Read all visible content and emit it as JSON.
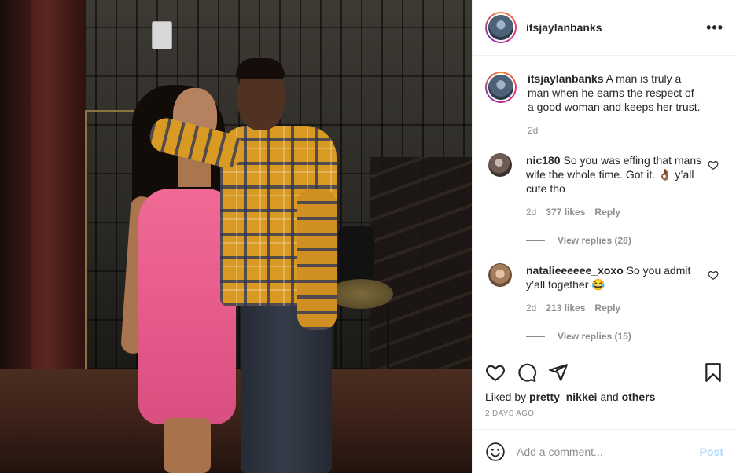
{
  "post": {
    "username": "itsjaylanbanks",
    "more_label": "•••"
  },
  "caption": {
    "username": "itsjaylanbanks",
    "text": "A man is truly a man when he earns the respect of a good woman and keeps her trust.",
    "time": "2d"
  },
  "comments": [
    {
      "username": "nic180",
      "text": "So you was effing that mans wife the whole time. Got it. 👌🏾 y’all cute tho",
      "time": "2d",
      "likes": "377 likes",
      "reply_label": "Reply",
      "view_replies": "View replies (28)"
    },
    {
      "username": "natalieeeeee_xoxo",
      "text": "So you admit y’all together 😂",
      "time": "2d",
      "likes": "213 likes",
      "reply_label": "Reply",
      "view_replies": "View replies (15)"
    }
  ],
  "actions": {
    "icons": [
      "heart-icon",
      "comment-icon",
      "share-icon",
      "bookmark-icon"
    ]
  },
  "liked_by": {
    "prefix": "Liked by",
    "user": "pretty_nikkei",
    "and": "and",
    "others": "others"
  },
  "timestamp": "2 DAYS AGO",
  "add_comment": {
    "placeholder": "Add a comment...",
    "post_label": "Post",
    "emoji_icon": "smiley-icon"
  },
  "colors": {
    "link_disabled": "#b3dbff",
    "muted": "#8e8e8e",
    "text": "#262626",
    "dress": "#e4588a"
  }
}
